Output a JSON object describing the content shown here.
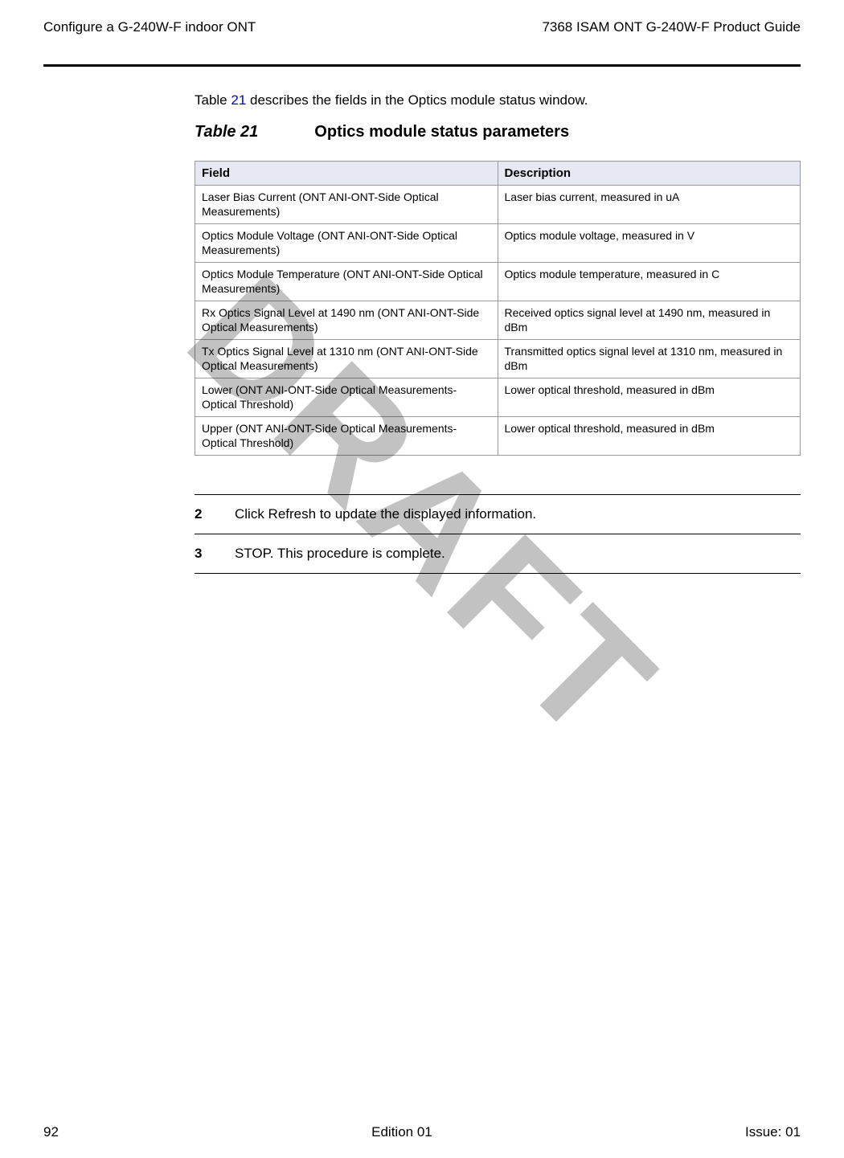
{
  "header": {
    "left": "Configure a G-240W-F indoor ONT",
    "right": "7368 ISAM ONT G-240W-F Product Guide"
  },
  "intro": {
    "pre": "Table ",
    "ref": "21",
    "post": " describes the fields in the Optics module status window."
  },
  "tableTitle": {
    "number": "Table 21",
    "text": "Optics module status parameters"
  },
  "tableHeaders": {
    "field": "Field",
    "description": "Description"
  },
  "rows": [
    {
      "field": "Laser Bias Current (ONT ANI-ONT-Side Optical Measurements)",
      "description": "Laser bias current, measured in uA"
    },
    {
      "field": "Optics Module Voltage (ONT ANI-ONT-Side Optical Measurements)",
      "description": "Optics module voltage, measured in V"
    },
    {
      "field": "Optics Module Temperature (ONT ANI-ONT-Side Optical Measurements)",
      "description": "Optics module temperature, measured in C"
    },
    {
      "field": "Rx Optics Signal Level at 1490 nm (ONT ANI-ONT-Side Optical Measurements)",
      "description": "Received optics signal level at 1490 nm, measured in dBm"
    },
    {
      "field": "Tx Optics Signal Level at 1310 nm (ONT ANI-ONT-Side Optical Measurements)",
      "description": "Transmitted optics signal level at 1310 nm, measured in dBm"
    },
    {
      "field": "Lower (ONT ANI-ONT-Side Optical Measurements-Optical Threshold)",
      "description": "Lower optical threshold, measured in dBm"
    },
    {
      "field": "Upper (ONT ANI-ONT-Side Optical Measurements-Optical Threshold)",
      "description": "Lower optical threshold, measured in dBm"
    }
  ],
  "steps": [
    {
      "num": "2",
      "text": "Click Refresh to update the displayed information."
    },
    {
      "num": "3",
      "text": "STOP. This procedure is complete."
    }
  ],
  "watermark": "DRAFT",
  "footer": {
    "left": "92",
    "center": "Edition 01",
    "right": "Issue: 01"
  }
}
